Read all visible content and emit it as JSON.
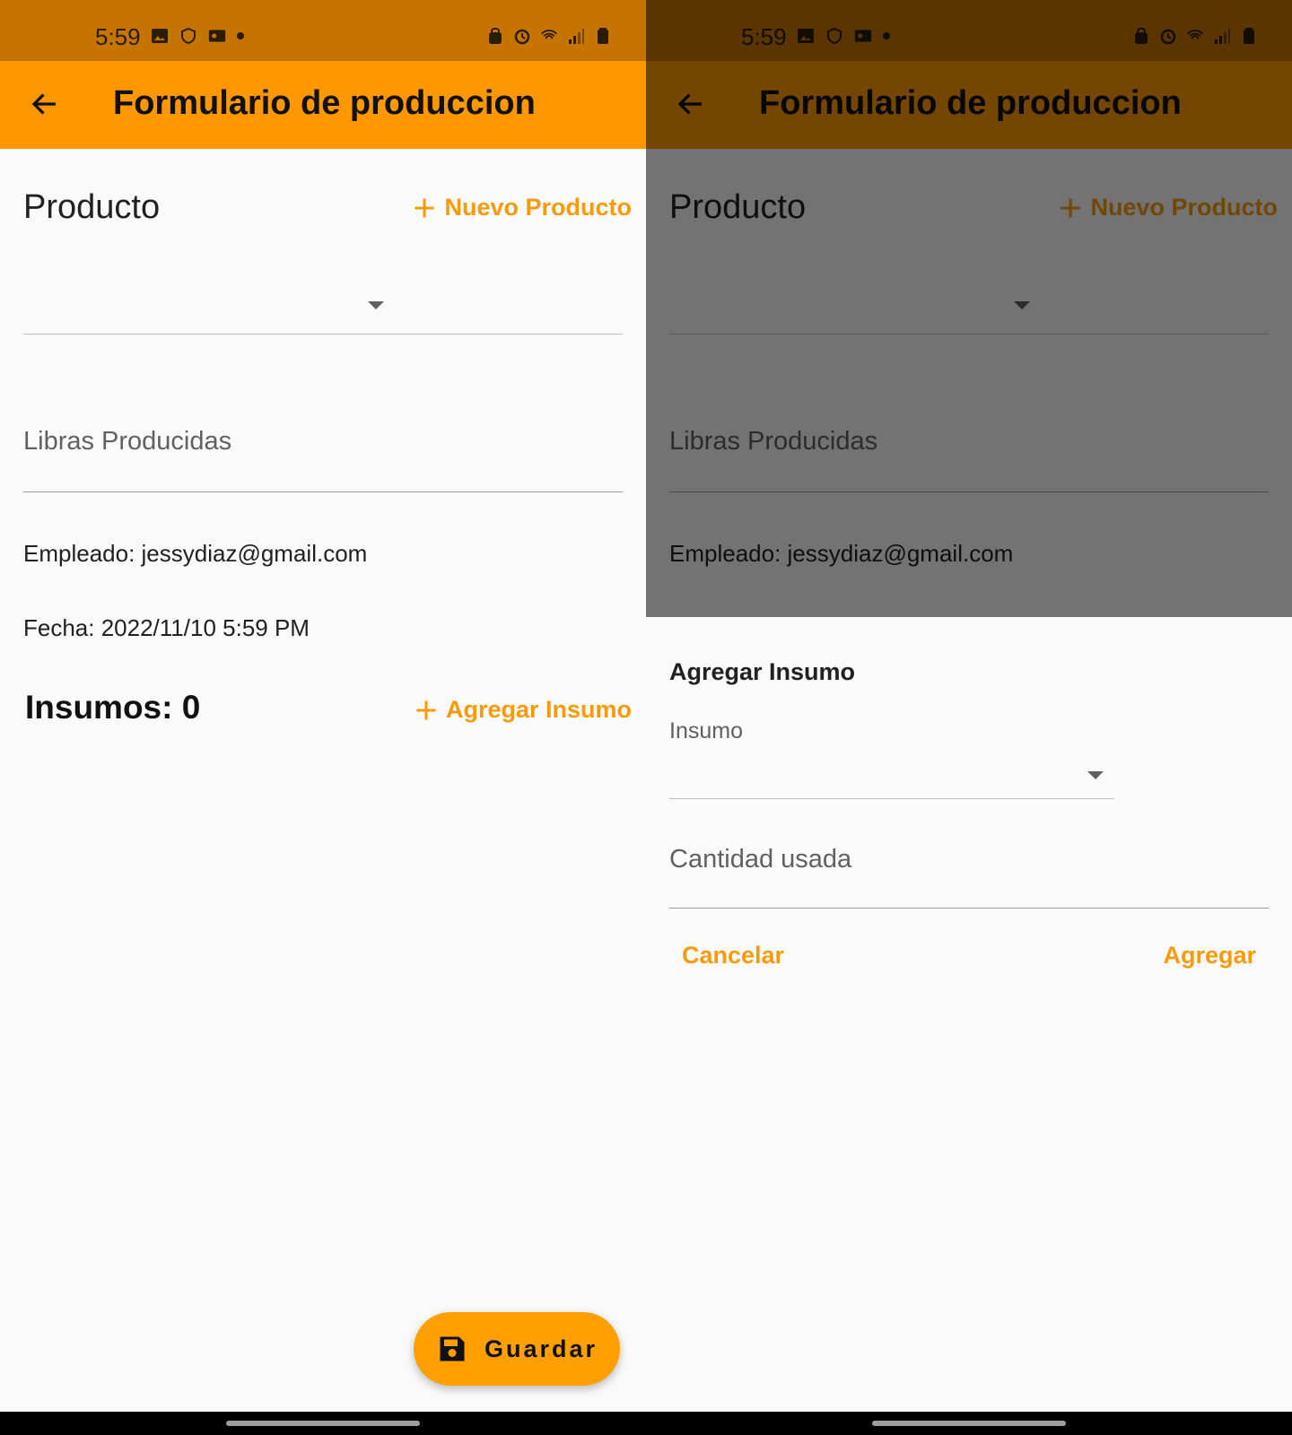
{
  "status_bar": {
    "time": "5:59"
  },
  "app_bar": {
    "title": "Formulario de produccion"
  },
  "form": {
    "producto_label": "Producto",
    "nuevo_producto": "Nuevo Producto",
    "libras_placeholder": "Libras Producidas",
    "empleado": "Empleado: jessydiaz@gmail.com",
    "fecha": "Fecha: 2022/11/10 5:59 PM",
    "insumos_count": "Insumos: 0",
    "agregar_insumo": "Agregar Insumo",
    "guardar": "Guardar"
  },
  "dialog": {
    "title": "Agregar Insumo",
    "insumo_label": "Insumo",
    "cantidad_placeholder": "Cantidad usada",
    "cancel": "Cancelar",
    "add": "Agregar"
  },
  "colors": {
    "accent": "#ff9800",
    "status_bar": "#c57400",
    "link": "#f59b0c"
  }
}
